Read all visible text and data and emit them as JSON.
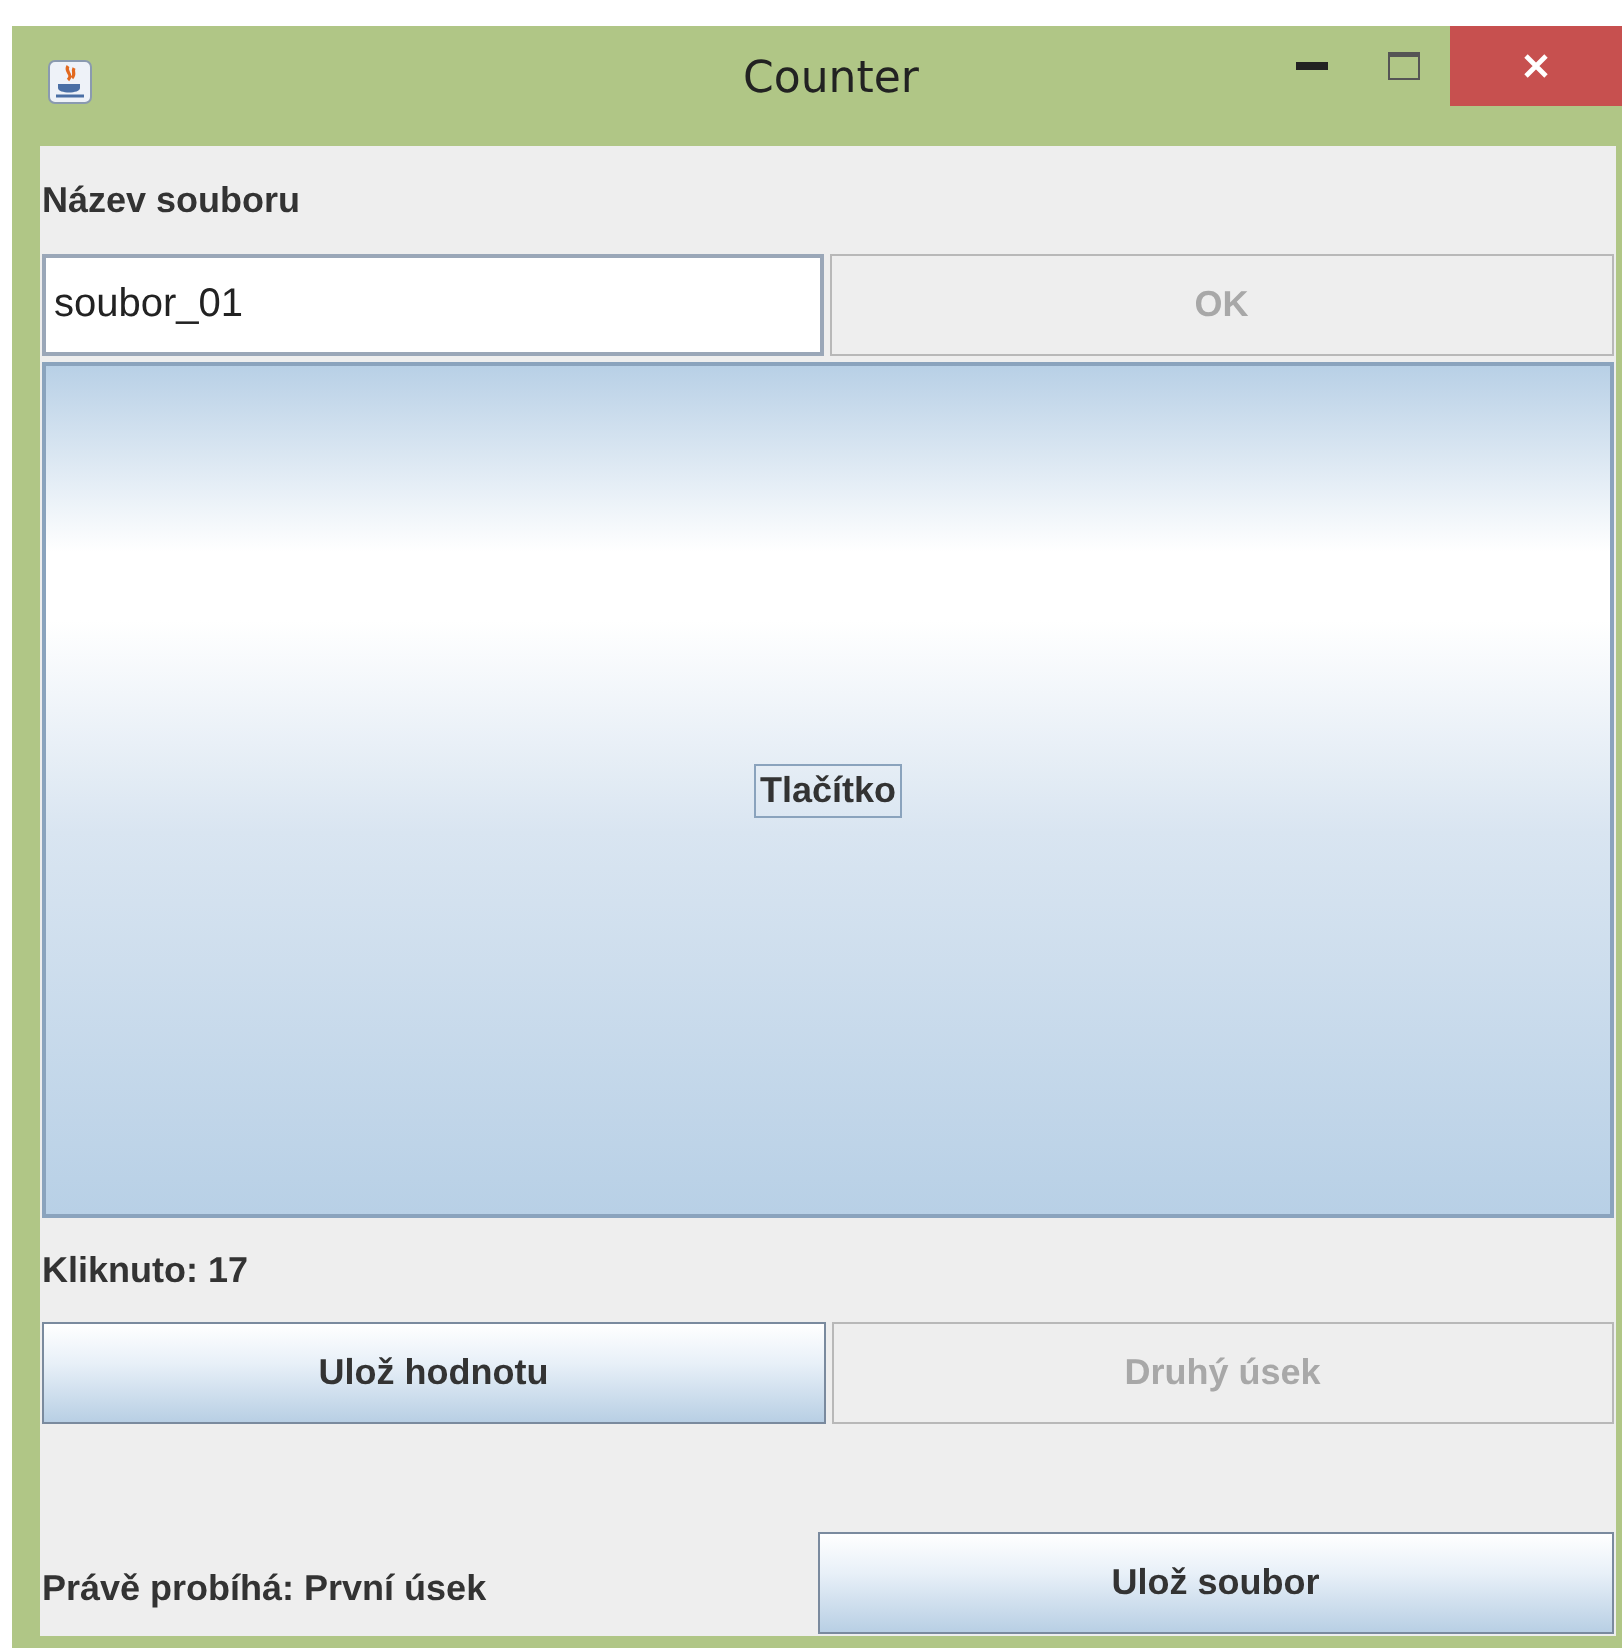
{
  "window": {
    "title": "Counter"
  },
  "file_label": "Název souboru",
  "file_field": {
    "value": "soubor_01"
  },
  "ok_button": {
    "label": "OK",
    "disabled": true
  },
  "main_button": {
    "label": "Tlačítko",
    "focused": true
  },
  "counter_text": "Kliknuto: 17",
  "action_buttons": [
    {
      "label": "Ulož hodnotu",
      "disabled": false
    },
    {
      "label": "Druhý úsek",
      "disabled": true
    }
  ],
  "status_text": "Právě probíhá: První úsek",
  "save_button": {
    "label": "Ulož soubor",
    "disabled": false
  }
}
